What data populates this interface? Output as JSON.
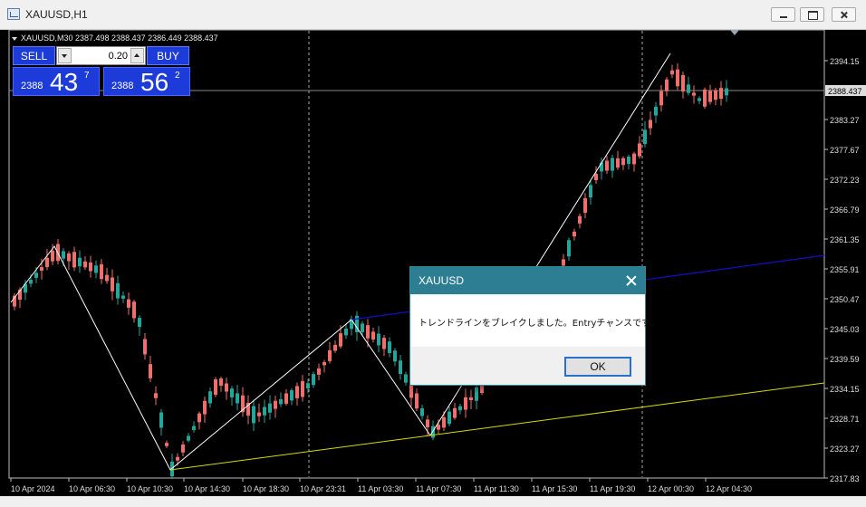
{
  "window": {
    "title": "XAUUSD,H1",
    "icons": {
      "app": "chart-window-icon",
      "minimize": "minimize-icon",
      "maximize": "restore-icon",
      "close": "close-icon"
    }
  },
  "chart": {
    "symbol_info": "XAUUSD,M30  2387.498 2388.437 2386.449 2388.437",
    "current_price_label": "2388.437",
    "price_axis_labels": [
      "2394.15",
      "2383.27",
      "2377.67",
      "2372.23",
      "2366.79",
      "2361.35",
      "2355.91",
      "2350.47",
      "2345.03",
      "2339.59",
      "2334.15",
      "2328.71",
      "2323.27",
      "2317.83"
    ],
    "time_axis_labels": [
      "10 Apr 2024",
      "10 Apr 06:30",
      "10 Apr 10:30",
      "10 Apr 14:30",
      "10 Apr 18:30",
      "10 Apr 23:31",
      "11 Apr 03:30",
      "11 Apr 07:30",
      "11 Apr 11:30",
      "11 Apr 15:30",
      "11 Apr 19:30",
      "12 Apr 00:30",
      "12 Apr 04:30"
    ],
    "colors": {
      "background": "#000000",
      "bull": "#26a69a",
      "bear": "#ef6f6c",
      "zigzag": "#ffffff",
      "support_line": "#d9d900",
      "trend_line": "#1010c8"
    }
  },
  "trade_panel": {
    "sell_label": "SELL",
    "buy_label": "BUY",
    "lot_value": "0.20",
    "sell_price": {
      "small": "2388",
      "big": "43",
      "sup": "7"
    },
    "buy_price": {
      "small": "2388",
      "big": "56",
      "sup": "2"
    }
  },
  "dialog": {
    "title": "XAUUSD",
    "message": "トレンドラインをブレイクしました。Entryチャンスです。",
    "ok_label": "OK"
  }
}
